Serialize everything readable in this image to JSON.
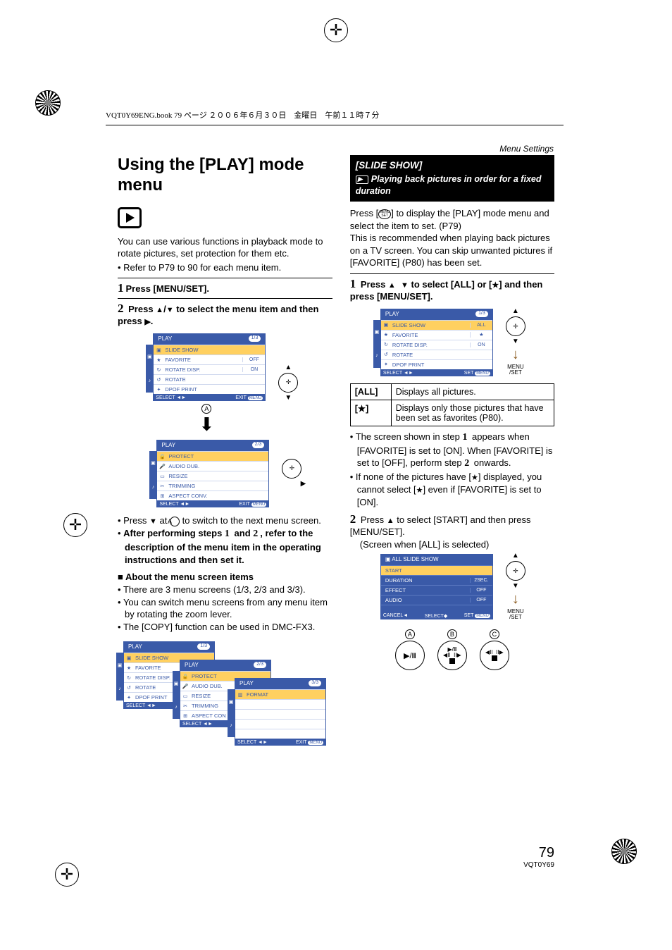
{
  "running_header": "Menu Settings",
  "book_line": "VQT0Y69ENG.book  79 ページ  ２００６年６月３０日　金曜日　午前１１時７分",
  "title": "Using the [PLAY] mode menu",
  "intro": "You can use various functions in playback mode to rotate pictures, set protection for them etc.",
  "intro_ref": "Refer to P79 to 90 for each menu item.",
  "step1": "Press [MENU/SET].",
  "step2_a": "Press ",
  "step2_b": "/",
  "step2_c": " to select the menu item and then press ",
  "step2_d": ".",
  "lcd1": {
    "title": "PLAY",
    "page": "1/3",
    "footer": {
      "l": "SELECT",
      "r": "EXIT"
    },
    "rows": [
      {
        "ic": "▣",
        "lab": "SLIDE SHOW",
        "val": "",
        "hl": true
      },
      {
        "ic": "★",
        "lab": "FAVORITE",
        "val": "OFF"
      },
      {
        "ic": "↻",
        "lab": "ROTATE DISP.",
        "val": "ON"
      },
      {
        "ic": "↺",
        "lab": "ROTATE",
        "val": ""
      },
      {
        "ic": "✦",
        "lab": "DPOF PRINT",
        "val": ""
      }
    ]
  },
  "lcd2": {
    "title": "PLAY",
    "page": "2/3",
    "footer": {
      "l": "SELECT",
      "r": "EXIT"
    },
    "rows": [
      {
        "ic": "🔒",
        "lab": "PROTECT",
        "val": "",
        "hl": true
      },
      {
        "ic": "🎤",
        "lab": "AUDIO DUB.",
        "val": ""
      },
      {
        "ic": "▭",
        "lab": "RESIZE",
        "val": ""
      },
      {
        "ic": "✂",
        "lab": "TRIMMING",
        "val": ""
      },
      {
        "ic": "⊞",
        "lab": "ASPECT CONV.",
        "val": ""
      }
    ]
  },
  "after_press": "Press ▼ at Ⓐ to switch to the next menu screen.",
  "after_bold": "After performing steps 1 and 2, refer to the description of the menu item in the operating instructions and then set it.",
  "about_hdr": "About the menu screen items",
  "about": [
    "There are 3 menu screens (1/3, 2/3 and 3/3).",
    "You can switch menu screens from any menu item by rotating the zoom lever.",
    "The [COPY] function can be used in DMC-FX3."
  ],
  "stacked": {
    "a": {
      "title": "PLAY",
      "page": "1/3",
      "rows": [
        "SLIDE SHOW",
        "FAVORITE",
        "ROTATE DISP.",
        "ROTATE",
        "DPOF PRINT"
      ],
      "footer": "SELECT"
    },
    "b": {
      "title": "PLAY",
      "page": "2/3",
      "rows": [
        "PROTECT",
        "AUDIO DUB.",
        "RESIZE",
        "TRIMMING",
        "ASPECT CON"
      ],
      "footer": "SELECT"
    },
    "c": {
      "title": "PLAY",
      "page": "3/3",
      "rows": [
        "FORMAT"
      ],
      "footer_l": "SELECT",
      "footer_r": "EXIT"
    }
  },
  "slide": {
    "heading": "[SLIDE SHOW]",
    "sub": "Playing back pictures in order for a fixed duration"
  },
  "slide_intro_a": "Press [",
  "slide_intro_b": "] to display the [PLAY] mode menu and select the item to set. (P79)",
  "slide_intro2": "This is recommended when playing back pictures on a TV screen. You can skip unwanted pictures if [FAVORITE] (P80) has been set.",
  "r_step1_a": "Press ",
  "r_step1_b": " to select [ALL] or [",
  "r_step1_c": "] and then press [MENU/SET].",
  "lcd3": {
    "title": "PLAY",
    "page": "1/3",
    "rows": [
      {
        "ic": "▣",
        "lab": "SLIDE SHOW",
        "val": "ALL",
        "hl": true
      },
      {
        "ic": "★",
        "lab": "FAVORITE",
        "val": "★"
      },
      {
        "ic": "↻",
        "lab": "ROTATE DISP.",
        "val": "ON"
      },
      {
        "ic": "↺",
        "lab": "ROTATE",
        "val": ""
      },
      {
        "ic": "✦",
        "lab": "DPOF PRINT",
        "val": ""
      }
    ],
    "footer": {
      "l": "SELECT",
      "r": "SET"
    }
  },
  "table": {
    "r1k": "[ALL]",
    "r1v": "Displays all pictures.",
    "r2k": "[★]",
    "r2v": "Displays only those pictures that have been set as favorites (P80)."
  },
  "r_notes": [
    "The screen shown in step 1 appears when [FAVORITE] is set to [ON]. When [FAVORITE] is set to [OFF], perform step 2 onwards.",
    "If none of the pictures have [★] displayed, you cannot select [★] even if [FAVORITE] is set to [ON]."
  ],
  "r_step2_a": "Press ",
  "r_step2_b": " to select [START] and then press [MENU/SET].",
  "r_step2_note": "(Screen when [ALL] is selected)",
  "lcd4": {
    "title": "ALL SLIDE SHOW",
    "rows": [
      {
        "lab": "START",
        "val": "",
        "hl": true
      },
      {
        "lab": "DURATION",
        "val": "2SEC."
      },
      {
        "lab": "EFFECT",
        "val": "OFF"
      },
      {
        "lab": "AUDIO",
        "val": "OFF"
      }
    ],
    "footer": {
      "a": "CANCEL",
      "b": "SELECT",
      "c": "SET"
    }
  },
  "page_number": "79",
  "page_code": "VQT0Y69"
}
